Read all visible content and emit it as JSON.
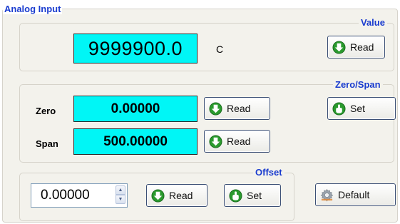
{
  "analog_input": {
    "title": "Analog Input",
    "value_group": {
      "title": "Value",
      "reading": "9999900.0",
      "unit": "C",
      "read_label": "Read"
    },
    "zero_span_group": {
      "title": "Zero/Span",
      "zero_label": "Zero",
      "zero_value": "0.00000",
      "zero_read_label": "Read",
      "span_label": "Span",
      "span_value": "500.00000",
      "span_read_label": "Read",
      "set_label": "Set"
    },
    "offset_group": {
      "title": "Offset",
      "offset_value": "0.00000",
      "read_label": "Read",
      "set_label": "Set"
    },
    "default_label": "Default"
  },
  "colors": {
    "group_title": "#1a3ccf",
    "display_bg": "#00f6f6",
    "read_icon": "#2a9a2e",
    "panel_bg": "#f3f2ec"
  },
  "icons": {
    "read": "green-down-arrow-icon",
    "set": "green-hand-icon",
    "default": "gear-icon"
  }
}
